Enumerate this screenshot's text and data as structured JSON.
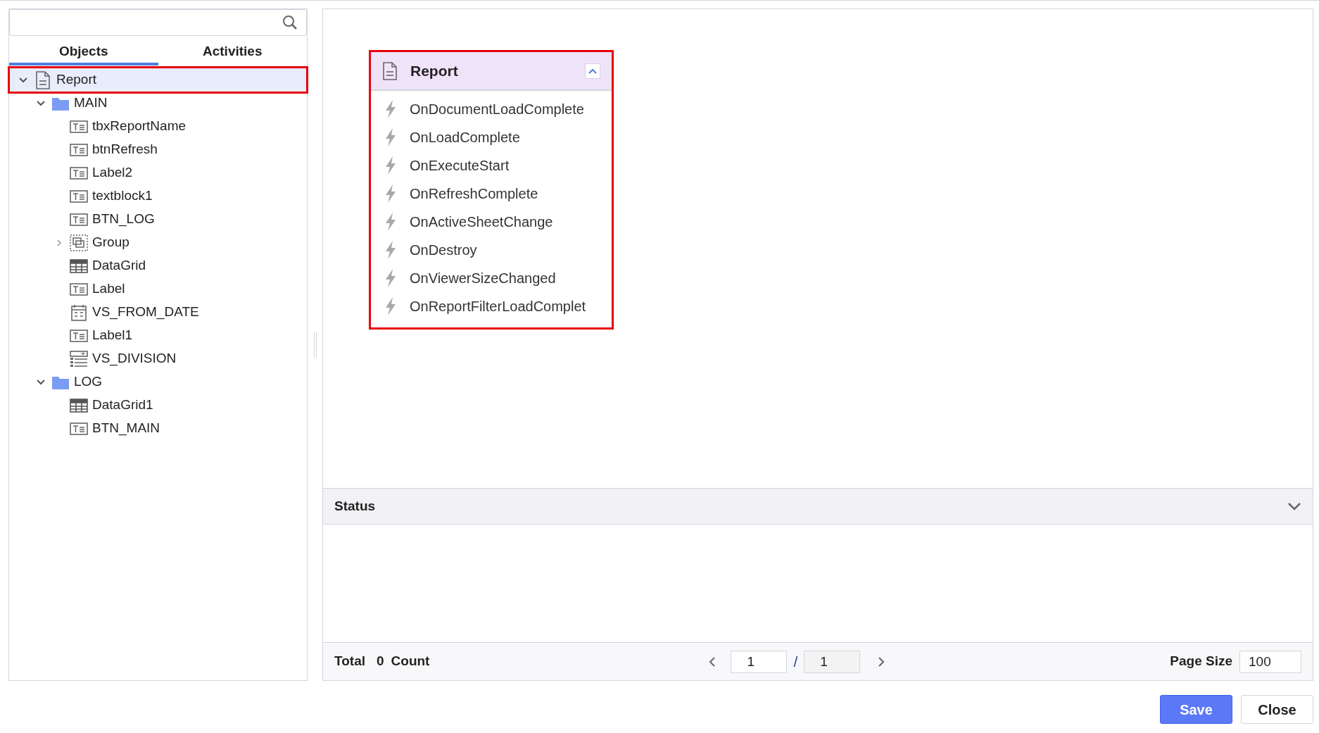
{
  "tabs": [
    {
      "label": "Objects",
      "selected": true
    },
    {
      "label": "Activities",
      "selected": false
    }
  ],
  "tree": [
    {
      "label": "Report",
      "kind": "report",
      "expanded": true,
      "selected": true,
      "highlighted": true,
      "children": [
        {
          "label": "MAIN",
          "kind": "folder",
          "expanded": true,
          "selected": false,
          "children": [
            {
              "label": "tbxReportName",
              "kind": "text",
              "selected": false
            },
            {
              "label": "btnRefresh",
              "kind": "text",
              "selected": false
            },
            {
              "label": "Label2",
              "kind": "text",
              "selected": false
            },
            {
              "label": "textblock1",
              "kind": "text",
              "selected": false
            },
            {
              "label": "BTN_LOG",
              "kind": "text",
              "selected": false
            },
            {
              "label": "Group",
              "kind": "group",
              "expanded": false,
              "selected": false
            },
            {
              "label": "DataGrid",
              "kind": "grid",
              "selected": false
            },
            {
              "label": "Label",
              "kind": "text",
              "selected": false
            },
            {
              "label": "VS_FROM_DATE",
              "kind": "date",
              "selected": false
            },
            {
              "label": "Label1",
              "kind": "text",
              "selected": false
            },
            {
              "label": "VS_DIVISION",
              "kind": "combo",
              "selected": false
            }
          ]
        },
        {
          "label": "LOG",
          "kind": "folder",
          "expanded": true,
          "selected": false,
          "children": [
            {
              "label": "DataGrid1",
              "kind": "grid",
              "selected": false
            },
            {
              "label": "BTN_MAIN",
              "kind": "text",
              "selected": false
            }
          ]
        }
      ]
    }
  ],
  "card": {
    "title": "Report",
    "expanded": true,
    "highlighted": true,
    "events": [
      "OnDocumentLoadComplete",
      "OnLoadComplete",
      "OnExecuteStart",
      "OnRefreshComplete",
      "OnActiveSheetChange",
      "OnDestroy",
      "OnViewerSizeChanged",
      "OnReportFilterLoadComplet"
    ]
  },
  "status": {
    "title": "Status"
  },
  "footer": {
    "total_label": "Total",
    "count": "0",
    "count_label": "Count",
    "page": "1",
    "separator": "/",
    "page_total": "1",
    "page_size_label": "Page Size",
    "page_size": "100"
  },
  "buttons": [
    {
      "label": "Save",
      "kind": "primary"
    },
    {
      "label": "Close",
      "kind": "secondary"
    }
  ]
}
